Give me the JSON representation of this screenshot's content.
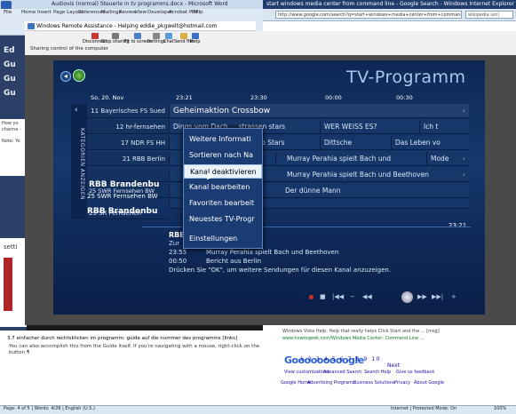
{
  "word": {
    "title": "Audiovis (normal) Steuerle in tv programms.docx - Microsoft Word",
    "tabs": [
      "File",
      "Home",
      "Insert",
      "Page Layout",
      "References",
      "Mailings",
      "Review",
      "View",
      "Developer",
      "Acrobat PDF",
      "Help"
    ],
    "lower_heading": "3.7 einfacher durch rechtsklicken im programm: guide auf die nummer des programms [links]",
    "lower_line1": "You can also accomplish this from the Guide itself. If you're navigating with a mouse, right-click on the channel to bring up the pop-up menu. If using remote, press the i",
    "lower_line2": "button.¶",
    "status": "Page: 4 of 5  |  Words: 4/26  |  English (U.S.)",
    "side_labels": [
      "Ed",
      "Gu",
      "Gu",
      "Gu"
    ],
    "side_note": "How yo  channe -",
    "side_label2": "Note: Yo",
    "settings_label": "setti"
  },
  "browser": {
    "title": "start windows media center from command line - Google Search - Windows Internet Explorer",
    "url": "http://www.google.com/search?q=start+windows+media+center+from+command+line",
    "search_placeholder": "wikipedia (en)",
    "result_text": "Windows Vista Help: Help that really helps Click Start and the ... [msg]",
    "result_url": "www.howtogeek.com/Windows Media Center: Command Line ...",
    "goog": "Gooooooooogle",
    "next": "Next",
    "links": [
      "View customizations",
      "Advanced Search",
      "Search Help",
      "Give us feedback"
    ],
    "footer": [
      "Google Home",
      "Advertising Programs",
      "Business Solutions",
      "Privacy",
      "About Google"
    ],
    "status": "Internet | Protected Mode: On",
    "zoom": "100%"
  },
  "remote_assistance": {
    "title": "Windows Remote Assistance - Helping eddie_pkgwelt@hotmail.com",
    "tools": [
      "Disconnect",
      "Stop sharing",
      "Fit to screen",
      "Settings",
      "Chat",
      "Send file",
      "Help"
    ],
    "status": "Sharing control of the computer"
  },
  "media_center": {
    "title": "TV-Programm",
    "date": "So, 20. Nov",
    "times": [
      "23:21",
      "23:30",
      "00:00",
      "00:30"
    ],
    "sidebar_label": "KATEGORIEN ANZEIGEN",
    "rows": [
      {
        "channel": "11 Bayerisches FS Sued",
        "programs": [
          {
            "title": "Geheimaktion Crossbow",
            "hl": true
          }
        ]
      },
      {
        "channel": "12 hr-fernsehen",
        "programs": [
          {
            "title": "Dings vom Dach ... strassen stars"
          },
          {
            "title": "WER WEISS ES?"
          },
          {
            "title": "Ich t"
          }
        ]
      },
      {
        "channel": "17 NDR FS HH",
        "programs": [
          {
            "title": "...tclub Stars"
          },
          {
            "title": "Dittsche"
          },
          {
            "title": "Das Leben vo"
          }
        ]
      },
      {
        "channel": "21 RBB Berlin",
        "programs": [
          {
            "title": "Murray Perahia spielt Bach und"
          },
          {
            "title": "Mode"
          }
        ]
      },
      {
        "channel": "",
        "programs": [
          {
            "title": "Murray Perahia spielt Bach und Beethoven"
          }
        ]
      },
      {
        "channel": "25 SWR Fernsehen BW",
        "programs": [
          {
            "title": "Der dünne Mann"
          }
        ]
      },
      {
        "channel": "25 SR Fernsehen",
        "programs": [
          {
            "title": ""
          }
        ]
      }
    ],
    "selected_channel": "RBB Brandenbu",
    "info_time": "23:21",
    "detail_title": "RBB",
    "detail_sub": "Zur",
    "details": [
      {
        "time": "23:55",
        "text": "Murray Perahia spielt Bach und Beethoven"
      },
      {
        "time": "00:50",
        "text": "Bericht aus Berlin"
      }
    ],
    "detail_note": "Drücken Sie \"OK\", um weitere Sendungen für diesen Kanal anzuzeigen.",
    "menu": [
      "Weitere Informati",
      "Sortieren nach Na",
      "Kanal deaktivieren",
      "Kanal bearbeiten",
      "Favoriten bearbeit",
      "Neuestes TV-Progr",
      "Einstellungen"
    ],
    "menu_selected_index": 2,
    "controls": [
      "■",
      "|◀◀",
      "−",
      "◀◀",
      "▶▶",
      "▶▶|",
      "+"
    ]
  }
}
